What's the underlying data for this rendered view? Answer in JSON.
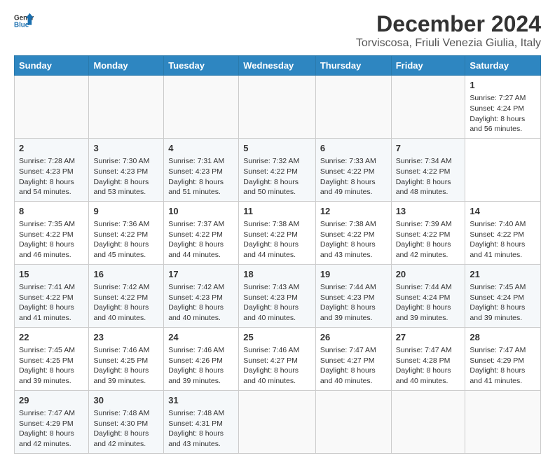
{
  "header": {
    "logo_general": "General",
    "logo_blue": "Blue",
    "title": "December 2024",
    "subtitle": "Torviscosa, Friuli Venezia Giulia, Italy"
  },
  "calendar": {
    "days_of_week": [
      "Sunday",
      "Monday",
      "Tuesday",
      "Wednesday",
      "Thursday",
      "Friday",
      "Saturday"
    ],
    "weeks": [
      [
        null,
        null,
        null,
        null,
        null,
        null,
        {
          "day": "1",
          "sunrise": "Sunrise: 7:27 AM",
          "sunset": "Sunset: 4:24 PM",
          "daylight": "Daylight: 8 hours and 56 minutes."
        }
      ],
      [
        {
          "day": "2",
          "sunrise": "Sunrise: 7:28 AM",
          "sunset": "Sunset: 4:23 PM",
          "daylight": "Daylight: 8 hours and 54 minutes."
        },
        {
          "day": "3",
          "sunrise": "Sunrise: 7:30 AM",
          "sunset": "Sunset: 4:23 PM",
          "daylight": "Daylight: 8 hours and 53 minutes."
        },
        {
          "day": "4",
          "sunrise": "Sunrise: 7:31 AM",
          "sunset": "Sunset: 4:23 PM",
          "daylight": "Daylight: 8 hours and 51 minutes."
        },
        {
          "day": "5",
          "sunrise": "Sunrise: 7:32 AM",
          "sunset": "Sunset: 4:22 PM",
          "daylight": "Daylight: 8 hours and 50 minutes."
        },
        {
          "day": "6",
          "sunrise": "Sunrise: 7:33 AM",
          "sunset": "Sunset: 4:22 PM",
          "daylight": "Daylight: 8 hours and 49 minutes."
        },
        {
          "day": "7",
          "sunrise": "Sunrise: 7:34 AM",
          "sunset": "Sunset: 4:22 PM",
          "daylight": "Daylight: 8 hours and 48 minutes."
        }
      ],
      [
        {
          "day": "8",
          "sunrise": "Sunrise: 7:35 AM",
          "sunset": "Sunset: 4:22 PM",
          "daylight": "Daylight: 8 hours and 46 minutes."
        },
        {
          "day": "9",
          "sunrise": "Sunrise: 7:36 AM",
          "sunset": "Sunset: 4:22 PM",
          "daylight": "Daylight: 8 hours and 45 minutes."
        },
        {
          "day": "10",
          "sunrise": "Sunrise: 7:37 AM",
          "sunset": "Sunset: 4:22 PM",
          "daylight": "Daylight: 8 hours and 44 minutes."
        },
        {
          "day": "11",
          "sunrise": "Sunrise: 7:38 AM",
          "sunset": "Sunset: 4:22 PM",
          "daylight": "Daylight: 8 hours and 44 minutes."
        },
        {
          "day": "12",
          "sunrise": "Sunrise: 7:38 AM",
          "sunset": "Sunset: 4:22 PM",
          "daylight": "Daylight: 8 hours and 43 minutes."
        },
        {
          "day": "13",
          "sunrise": "Sunrise: 7:39 AM",
          "sunset": "Sunset: 4:22 PM",
          "daylight": "Daylight: 8 hours and 42 minutes."
        },
        {
          "day": "14",
          "sunrise": "Sunrise: 7:40 AM",
          "sunset": "Sunset: 4:22 PM",
          "daylight": "Daylight: 8 hours and 41 minutes."
        }
      ],
      [
        {
          "day": "15",
          "sunrise": "Sunrise: 7:41 AM",
          "sunset": "Sunset: 4:22 PM",
          "daylight": "Daylight: 8 hours and 41 minutes."
        },
        {
          "day": "16",
          "sunrise": "Sunrise: 7:42 AM",
          "sunset": "Sunset: 4:22 PM",
          "daylight": "Daylight: 8 hours and 40 minutes."
        },
        {
          "day": "17",
          "sunrise": "Sunrise: 7:42 AM",
          "sunset": "Sunset: 4:23 PM",
          "daylight": "Daylight: 8 hours and 40 minutes."
        },
        {
          "day": "18",
          "sunrise": "Sunrise: 7:43 AM",
          "sunset": "Sunset: 4:23 PM",
          "daylight": "Daylight: 8 hours and 40 minutes."
        },
        {
          "day": "19",
          "sunrise": "Sunrise: 7:44 AM",
          "sunset": "Sunset: 4:23 PM",
          "daylight": "Daylight: 8 hours and 39 minutes."
        },
        {
          "day": "20",
          "sunrise": "Sunrise: 7:44 AM",
          "sunset": "Sunset: 4:24 PM",
          "daylight": "Daylight: 8 hours and 39 minutes."
        },
        {
          "day": "21",
          "sunrise": "Sunrise: 7:45 AM",
          "sunset": "Sunset: 4:24 PM",
          "daylight": "Daylight: 8 hours and 39 minutes."
        }
      ],
      [
        {
          "day": "22",
          "sunrise": "Sunrise: 7:45 AM",
          "sunset": "Sunset: 4:25 PM",
          "daylight": "Daylight: 8 hours and 39 minutes."
        },
        {
          "day": "23",
          "sunrise": "Sunrise: 7:46 AM",
          "sunset": "Sunset: 4:25 PM",
          "daylight": "Daylight: 8 hours and 39 minutes."
        },
        {
          "day": "24",
          "sunrise": "Sunrise: 7:46 AM",
          "sunset": "Sunset: 4:26 PM",
          "daylight": "Daylight: 8 hours and 39 minutes."
        },
        {
          "day": "25",
          "sunrise": "Sunrise: 7:46 AM",
          "sunset": "Sunset: 4:27 PM",
          "daylight": "Daylight: 8 hours and 40 minutes."
        },
        {
          "day": "26",
          "sunrise": "Sunrise: 7:47 AM",
          "sunset": "Sunset: 4:27 PM",
          "daylight": "Daylight: 8 hours and 40 minutes."
        },
        {
          "day": "27",
          "sunrise": "Sunrise: 7:47 AM",
          "sunset": "Sunset: 4:28 PM",
          "daylight": "Daylight: 8 hours and 40 minutes."
        },
        {
          "day": "28",
          "sunrise": "Sunrise: 7:47 AM",
          "sunset": "Sunset: 4:29 PM",
          "daylight": "Daylight: 8 hours and 41 minutes."
        }
      ],
      [
        {
          "day": "29",
          "sunrise": "Sunrise: 7:47 AM",
          "sunset": "Sunset: 4:29 PM",
          "daylight": "Daylight: 8 hours and 42 minutes."
        },
        {
          "day": "30",
          "sunrise": "Sunrise: 7:48 AM",
          "sunset": "Sunset: 4:30 PM",
          "daylight": "Daylight: 8 hours and 42 minutes."
        },
        {
          "day": "31",
          "sunrise": "Sunrise: 7:48 AM",
          "sunset": "Sunset: 4:31 PM",
          "daylight": "Daylight: 8 hours and 43 minutes."
        },
        null,
        null,
        null,
        null
      ]
    ]
  }
}
